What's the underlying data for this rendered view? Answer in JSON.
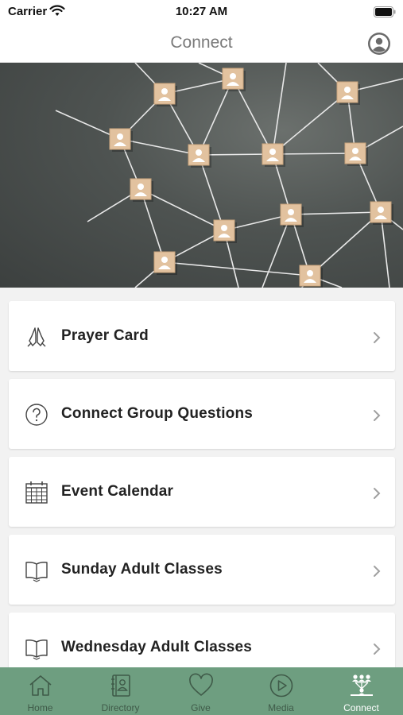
{
  "status_bar": {
    "carrier": "Carrier",
    "time": "10:27 AM"
  },
  "nav": {
    "title": "Connect",
    "profile_icon": "person-circle-icon"
  },
  "hero": {
    "image": "network-of-people-blocks"
  },
  "menu": [
    {
      "label": "Prayer Card",
      "icon": "praying-hands-icon"
    },
    {
      "label": "Connect Group Questions",
      "icon": "question-circle-icon"
    },
    {
      "label": "Event Calendar",
      "icon": "calendar-icon"
    },
    {
      "label": "Sunday Adult Classes",
      "icon": "open-book-icon"
    },
    {
      "label": "Wednesday Adult Classes",
      "icon": "open-book-icon"
    }
  ],
  "tabs": [
    {
      "label": "Home",
      "icon": "house-icon",
      "active": false
    },
    {
      "label": "Directory",
      "icon": "directory-icon",
      "active": false
    },
    {
      "label": "Give",
      "icon": "heart-icon",
      "active": false
    },
    {
      "label": "Media",
      "icon": "play-circle-icon",
      "active": false
    },
    {
      "label": "Connect",
      "icon": "people-network-icon",
      "active": true
    }
  ],
  "colors": {
    "tab_bar": "#6e9e80",
    "tab_inactive": "#3f5a48",
    "tab_active": "#ffffff",
    "nav_title": "#7a7a7a"
  }
}
